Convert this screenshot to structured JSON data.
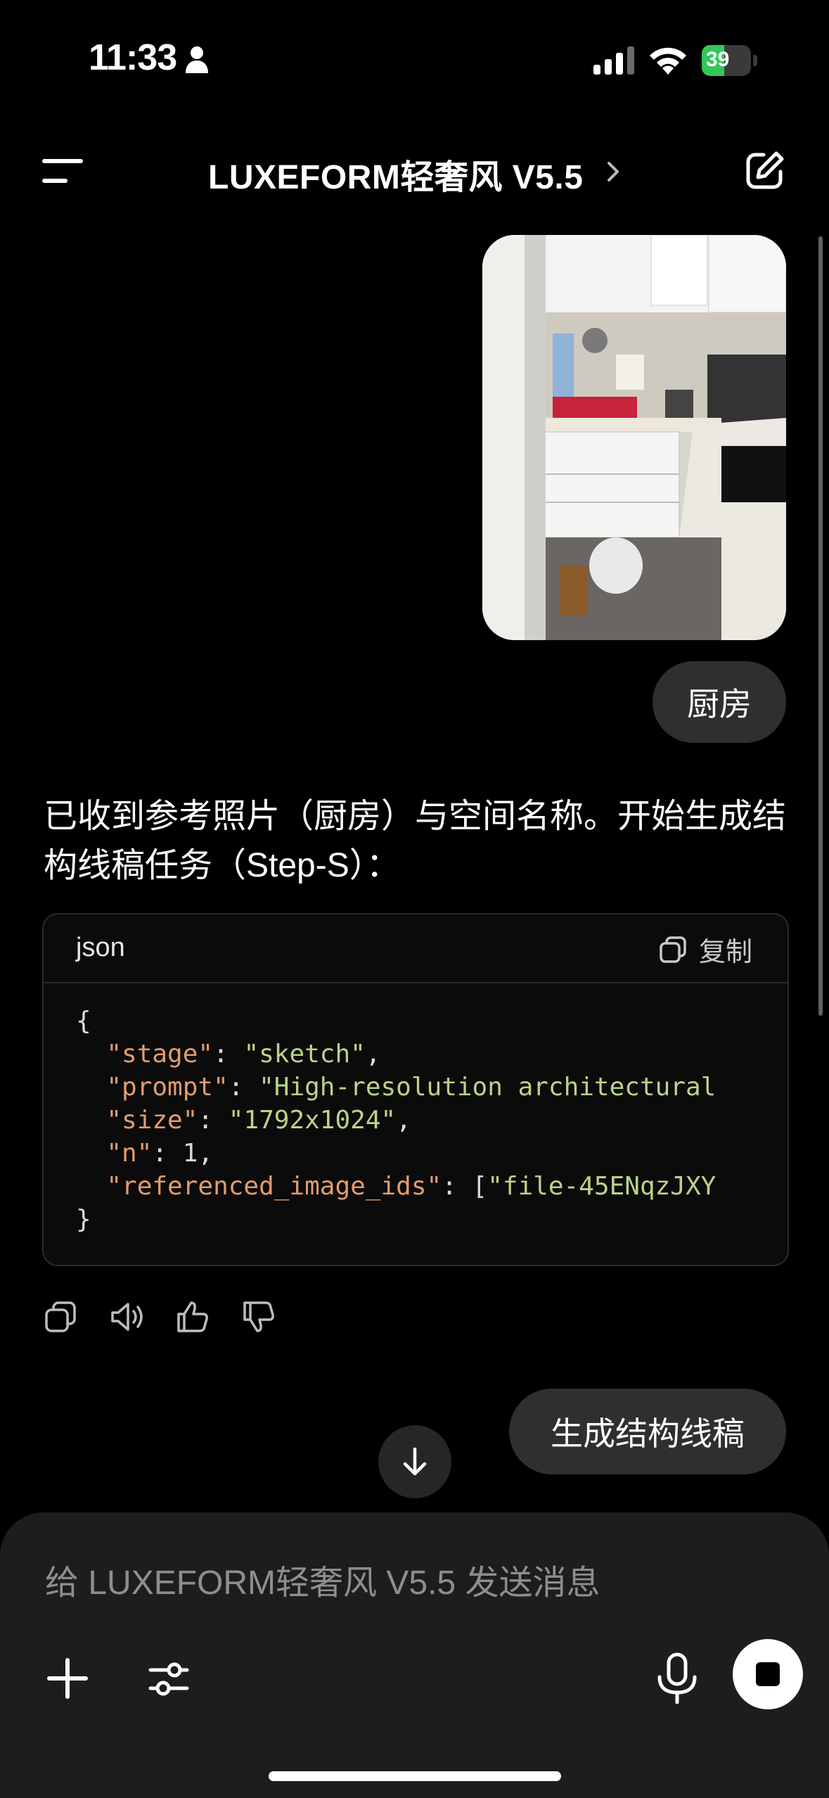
{
  "status_bar": {
    "time": "11:33",
    "battery": "39",
    "battery_level": 0.39
  },
  "header": {
    "title": "LUXEFORM轻奢风 V5.5"
  },
  "messages": {
    "user_text_1": "厨房",
    "assistant_reply": "已收到参考照片（厨房）与空间名称。开始生成结构线稿任务（Step-S）：",
    "code": {
      "language": "json",
      "copy_label": "复制",
      "lines": [
        "{",
        "  \"stage\": \"sketch\",",
        "  \"prompt\": \"High-resolution architectural",
        "  \"size\": \"1792x1024\",",
        "  \"n\": 1,",
        "  \"referenced_image_ids\": [\"file-45ENqzJXY",
        "}"
      ]
    },
    "user_text_2": "生成结构线稿"
  },
  "composer": {
    "placeholder": "给 LUXEFORM轻奢风 V5.5 发送消息"
  },
  "colors": {
    "background": "#000000",
    "bubble": "#2f2f2f",
    "composer": "#1d1d1d",
    "battery": "#34c759"
  }
}
